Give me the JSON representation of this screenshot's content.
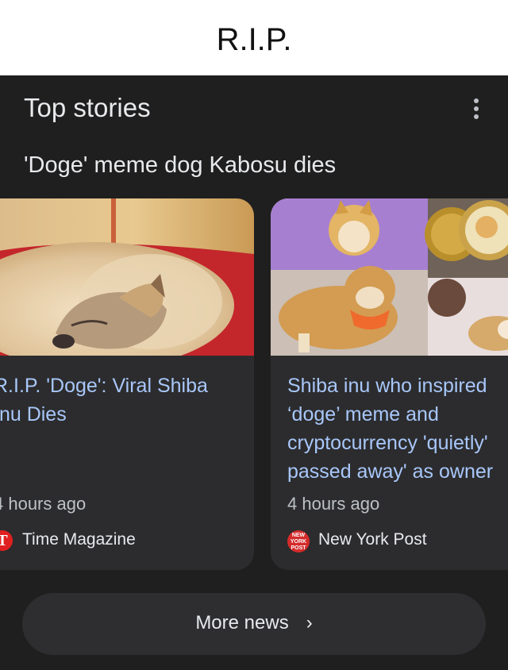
{
  "caption": "R.I.P.",
  "top_stories": {
    "section_title": "Top stories",
    "headline": "'Doge' meme dog Kabosu dies",
    "cards": [
      {
        "title_lines": [
          "R.I.P. 'Doge': Viral Shiba",
          "Inu Dies"
        ],
        "time": "4 hours ago",
        "source": "Time Magazine",
        "source_logo": "T"
      },
      {
        "title_lines": [
          "Shiba inu who inspired",
          "‘doge’ meme and",
          "cryptocurrency 'quietly'",
          "passed away' as owner"
        ],
        "time": "4 hours ago",
        "source": "New York Post",
        "source_logo": "NEW YORK POST"
      }
    ],
    "more_button": "More news",
    "more_icon": "chevron-right-icon"
  },
  "colors": {
    "panel_bg": "#1f1f1f",
    "card_bg": "#2c2c2e",
    "link_blue": "#a8c7fa",
    "text": "#e8eaed"
  }
}
